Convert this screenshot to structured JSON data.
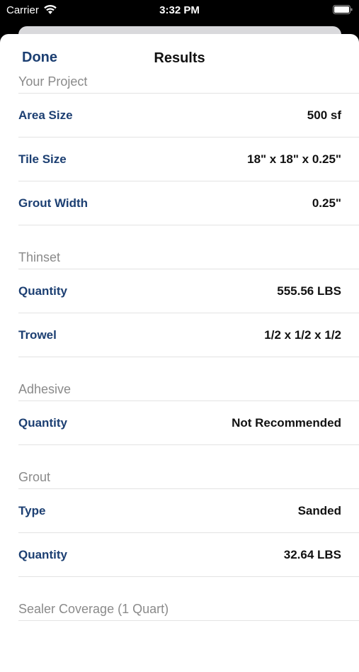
{
  "status_bar": {
    "carrier": "Carrier",
    "time": "3:32 PM"
  },
  "nav": {
    "done_label": "Done",
    "title": "Results"
  },
  "sections": [
    {
      "header": "Your Project",
      "rows": [
        {
          "label": "Area Size",
          "value": "500 sf"
        },
        {
          "label": "Tile Size",
          "value": "18\" x 18\" x 0.25\""
        },
        {
          "label": "Grout Width",
          "value": "0.25\""
        }
      ]
    },
    {
      "header": "Thinset",
      "rows": [
        {
          "label": "Quantity",
          "value": "555.56 LBS"
        },
        {
          "label": "Trowel",
          "value": "1/2 x 1/2 x 1/2"
        }
      ]
    },
    {
      "header": "Adhesive",
      "rows": [
        {
          "label": "Quantity",
          "value": "Not Recommended"
        }
      ]
    },
    {
      "header": "Grout",
      "rows": [
        {
          "label": "Type",
          "value": "Sanded"
        },
        {
          "label": "Quantity",
          "value": "32.64 LBS"
        }
      ]
    },
    {
      "header": "Sealer Coverage (1 Quart)",
      "rows": []
    }
  ],
  "colors": {
    "accent": "#1c3f72",
    "header_text": "#8a8a8a",
    "separator": "#e3e3e3"
  },
  "icons": {
    "wifi": "wifi-icon",
    "battery": "battery-icon"
  }
}
